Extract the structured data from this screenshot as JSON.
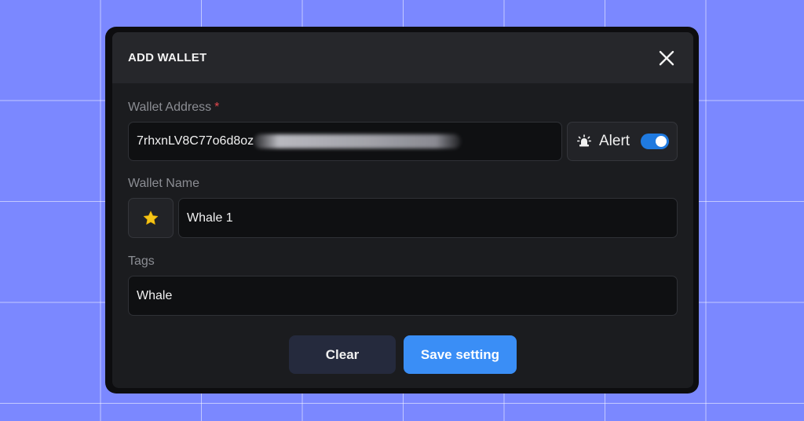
{
  "modal": {
    "title": "ADD WALLET",
    "close_icon": "close-icon"
  },
  "wallet_address": {
    "label": "Wallet Address",
    "required_marker": "*",
    "value_visible": "7rhxnLV8C77o6d8oz",
    "value_obscured": true
  },
  "alert": {
    "icon": "siren-icon",
    "label": "Alert",
    "enabled": true
  },
  "wallet_name": {
    "label": "Wallet Name",
    "emoji_icon": "star-icon",
    "value": "Whale 1"
  },
  "tags": {
    "label": "Tags",
    "value": "Whale"
  },
  "actions": {
    "clear_label": "Clear",
    "save_label": "Save setting"
  },
  "colors": {
    "background": "#7b88ff",
    "modal_bg": "#1b1c1f",
    "header_bg": "#26272b",
    "input_bg": "#0f1012",
    "accent": "#3a8ef6",
    "toggle_on": "#1f7ae0",
    "required": "#e5484d",
    "star": "#f5c518"
  }
}
